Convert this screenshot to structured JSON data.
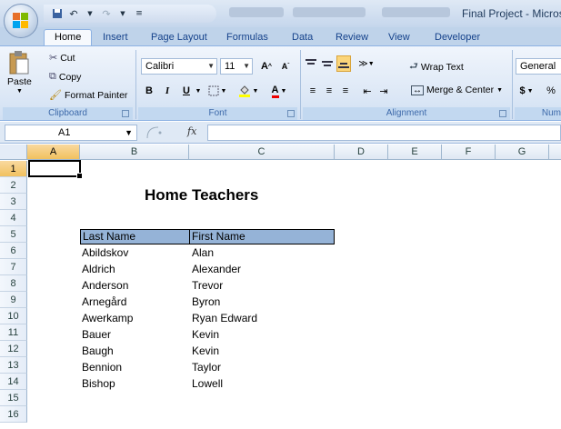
{
  "window": {
    "title": "Final Project - Microso"
  },
  "tabs": [
    "Home",
    "Insert",
    "Page Layout",
    "Formulas",
    "Data",
    "Review",
    "View",
    "Developer"
  ],
  "ribbon": {
    "clipboard": {
      "label": "Clipboard",
      "paste": "Paste",
      "cut": "Cut",
      "copy": "Copy",
      "format_painter": "Format Painter"
    },
    "font": {
      "label": "Font",
      "name": "Calibri",
      "size": "11",
      "bold": "B",
      "italic": "I",
      "underline": "U"
    },
    "alignment": {
      "label": "Alignment",
      "wrap_text": "Wrap Text",
      "merge_center": "Merge & Center"
    },
    "number": {
      "label": "Num",
      "format": "General",
      "currency": "$",
      "percent": "%"
    }
  },
  "formula_bar": {
    "name_box": "A1",
    "fx": "fx",
    "value": ""
  },
  "grid": {
    "columns": [
      "A",
      "B",
      "C",
      "D",
      "E",
      "F",
      "G"
    ],
    "rows": [
      "1",
      "2",
      "3",
      "4",
      "5",
      "6",
      "7",
      "8",
      "9",
      "10",
      "11",
      "12",
      "13",
      "14",
      "15",
      "16"
    ],
    "active_cell": "A1",
    "title": "Home Teachers",
    "headers": {
      "last": "Last Name",
      "first": "First Name"
    },
    "people": [
      {
        "last": "Abildskov",
        "first": "Alan"
      },
      {
        "last": "Aldrich",
        "first": "Alexander"
      },
      {
        "last": "Anderson",
        "first": "Trevor"
      },
      {
        "last": "Arnegård",
        "first": "Byron"
      },
      {
        "last": "Awerkamp",
        "first": "Ryan Edward"
      },
      {
        "last": "Bauer",
        "first": "Kevin"
      },
      {
        "last": "Baugh",
        "first": "Kevin"
      },
      {
        "last": "Bennion",
        "first": "Taylor"
      },
      {
        "last": "Bishop",
        "first": "Lowell"
      }
    ]
  },
  "colors": {
    "header_fill": "#95b3d7",
    "ribbon": "#dfe9f5",
    "selection": "#f1c15f"
  }
}
